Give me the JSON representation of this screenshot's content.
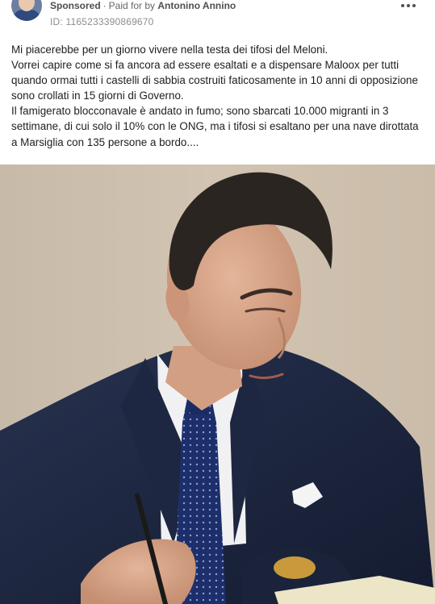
{
  "ad": {
    "sponsored_label": "Sponsored",
    "separator": "·",
    "paid_for_label": "Paid for by",
    "advertiser": "Antonino Annino",
    "library_id": "ID: 1165233390869670"
  },
  "post": {
    "paragraphs": [
      "Mi piacerebbe per un giorno vivere nella testa dei tifosi del Meloni.",
      "Vorrei capire come si fa ancora ad essere esaltati e a dispensare Maloox per tutti quando ormai tutti i castelli di sabbia costruiti faticosamente in 10 anni di opposizione sono crollati in 15 giorni di Governo.",
      "Il famigerato blocconavale è andato in fumo; sono sbarcati 10.000 migranti in 3 settimane, di cui solo il 10% con le ONG, ma i tifosi si esaltano per una nave dirottata a Marsiglia con 135 persone a bordo...."
    ]
  },
  "icons": {
    "more": "more-horizontal-icon",
    "avatar": "advertiser-avatar"
  },
  "colors": {
    "text": "#1c1e21",
    "secondary_text": "#65676b",
    "photo_background": "#d0c2b0",
    "suit": "#1a2540",
    "tie": "#1c2f6b",
    "shirt": "#f4f4f6"
  }
}
